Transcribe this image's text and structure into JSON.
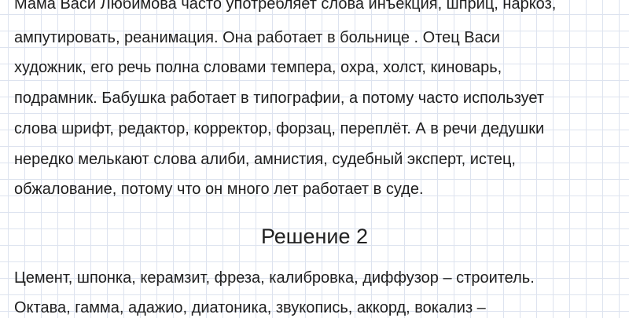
{
  "paragraph1": {
    "lines": [
      "Мама Васи Любимова часто употребляет слова инъекция, шприц, наркоз,",
      "ампутировать, реанимация. Она работает в больнице . Отец Васи",
      "художник, его речь полна словами темпера, охра, холст, киноварь,",
      "подрамник. Бабушка работает в типографии, а потому часто использует",
      "слова шрифт, редактор, корректор, форзац, переплёт. А в речи дедушки",
      "нередко мелькают слова алиби, амнистия, судебный эксперт, истец,",
      "обжалование, потому что он много лет работает в суде."
    ]
  },
  "solution_heading": "Решение 2",
  "paragraph2": {
    "lines": [
      "Цемент, шпонка, керамзит, фреза, калибровка, диффузор – строитель.",
      "Октава, гамма, адажио, диатоника, звукопись, аккорд, вокализ –"
    ]
  }
}
